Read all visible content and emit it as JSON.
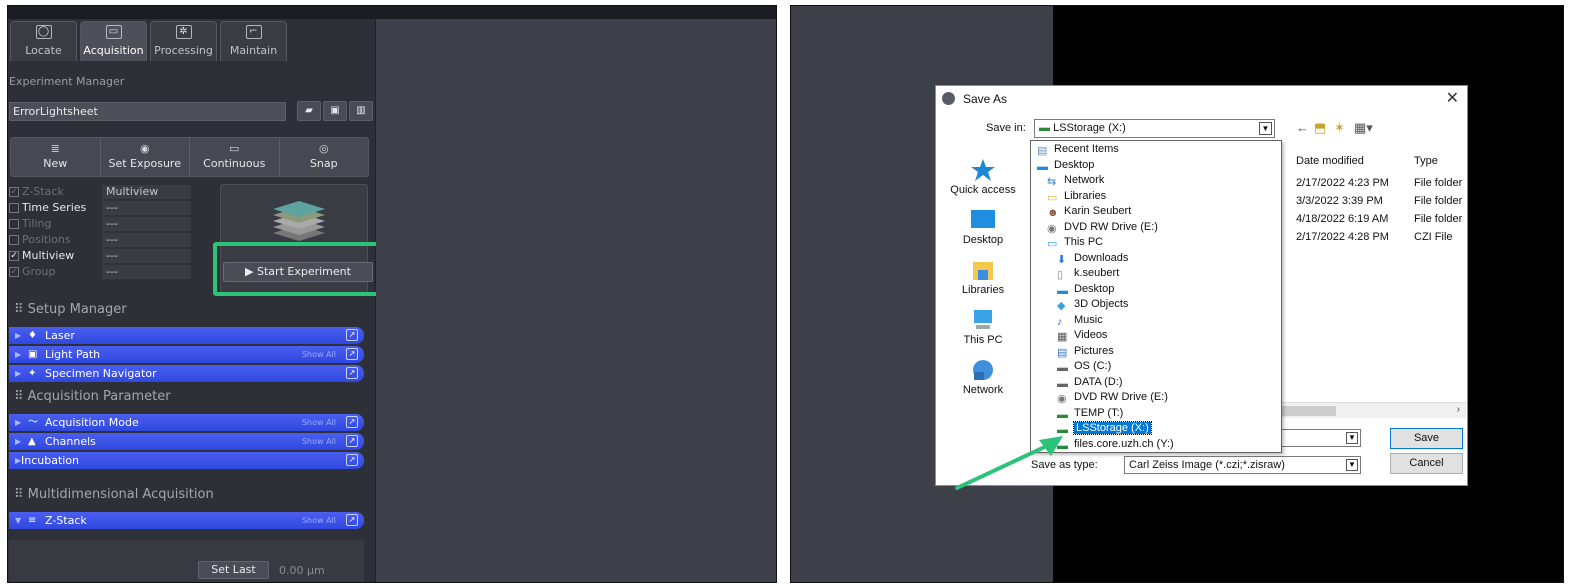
{
  "zeiss": {
    "tabs": [
      "Locate",
      "Acquisition",
      "Processing",
      "Maintain"
    ],
    "experiment_manager_label": "Experiment Manager",
    "experiment_name": "ErrorLightsheet",
    "toolbar": {
      "new": "New",
      "set_exposure": "Set Exposure",
      "continuous": "Continuous",
      "snap": "Snap"
    },
    "dimensions": [
      {
        "name": "Z-Stack",
        "value": "Multiview",
        "checked": true,
        "enabled": false
      },
      {
        "name": "Time Series",
        "value": "---",
        "checked": false,
        "enabled": true
      },
      {
        "name": "Tiling",
        "value": "---",
        "checked": false,
        "enabled": false
      },
      {
        "name": "Positions",
        "value": "---",
        "checked": false,
        "enabled": false
      },
      {
        "name": "Multiview",
        "value": "---",
        "checked": true,
        "enabled": true
      },
      {
        "name": "Group",
        "value": "---",
        "checked": true,
        "enabled": false
      }
    ],
    "start_experiment": "Start Experiment",
    "setup_manager": "Setup Manager",
    "setup_tools": [
      {
        "label": "Laser",
        "show_all": false
      },
      {
        "label": "Light Path",
        "show_all": true
      },
      {
        "label": "Specimen Navigator",
        "show_all": false
      }
    ],
    "acquisition_parameter": "Acquisition Parameter",
    "acq_tools": [
      {
        "label": "Acquisition Mode",
        "show_all": true
      },
      {
        "label": "Channels",
        "show_all": true
      },
      {
        "label": "Incubation",
        "show_all": false
      }
    ],
    "multidimensional_acquisition": "Multidimensional Acquisition",
    "zstack_tool": {
      "label": "Z-Stack",
      "show_all": true
    },
    "show_all_label": "Show All",
    "set_last": "Set Last",
    "z_value": "0.00 µm",
    "highlight_color": "#2bc27a"
  },
  "dialog": {
    "title": "Save As",
    "save_in_label": "Save in:",
    "save_in_value": "LSStorage (X:)",
    "places": [
      "Quick access",
      "Desktop",
      "Libraries",
      "This PC",
      "Network"
    ],
    "columns": [
      "Date modified",
      "Type"
    ],
    "rows": [
      {
        "date": "2/17/2022 4:23 PM",
        "type": "File folder"
      },
      {
        "date": "3/3/2022 3:39 PM",
        "type": "File folder"
      },
      {
        "date": "4/18/2022 6:19 AM",
        "type": "File folder"
      },
      {
        "date": "2/17/2022 4:28 PM",
        "type": "CZI File"
      }
    ],
    "dropdown_items": [
      {
        "label": "Recent Items",
        "indent": 0,
        "icon": "recent"
      },
      {
        "label": "Desktop",
        "indent": 0,
        "icon": "desktop"
      },
      {
        "label": "Network",
        "indent": 1,
        "icon": "network"
      },
      {
        "label": "Libraries",
        "indent": 1,
        "icon": "folder"
      },
      {
        "label": "Karin Seubert",
        "indent": 1,
        "icon": "user"
      },
      {
        "label": "DVD RW Drive (E:)",
        "indent": 1,
        "icon": "dvd"
      },
      {
        "label": "This PC",
        "indent": 1,
        "icon": "pc"
      },
      {
        "label": "Downloads",
        "indent": 2,
        "icon": "download"
      },
      {
        "label": "k.seubert",
        "indent": 2,
        "icon": "file"
      },
      {
        "label": "Desktop",
        "indent": 2,
        "icon": "desktop"
      },
      {
        "label": "3D Objects",
        "indent": 2,
        "icon": "cube"
      },
      {
        "label": "Music",
        "indent": 2,
        "icon": "music"
      },
      {
        "label": "Videos",
        "indent": 2,
        "icon": "video"
      },
      {
        "label": "Pictures",
        "indent": 2,
        "icon": "picture"
      },
      {
        "label": "OS (C:)",
        "indent": 2,
        "icon": "drive"
      },
      {
        "label": "DATA (D:)",
        "indent": 2,
        "icon": "drive"
      },
      {
        "label": "DVD RW Drive (E:)",
        "indent": 2,
        "icon": "dvd"
      },
      {
        "label": "TEMP (T:)",
        "indent": 2,
        "icon": "netdrive"
      },
      {
        "label": "LSStorage (X:)",
        "indent": 2,
        "icon": "netdrive",
        "selected": true
      },
      {
        "label": "files.core.uzh.ch (Y:)",
        "indent": 2,
        "icon": "netdrive"
      }
    ],
    "save_as_type_label": "Save as type:",
    "save_as_type_value": "Carl Zeiss Image (*.czi;*.zisraw)",
    "save_button": "Save",
    "cancel_button": "Cancel",
    "arrow_color": "#2bc27a"
  }
}
